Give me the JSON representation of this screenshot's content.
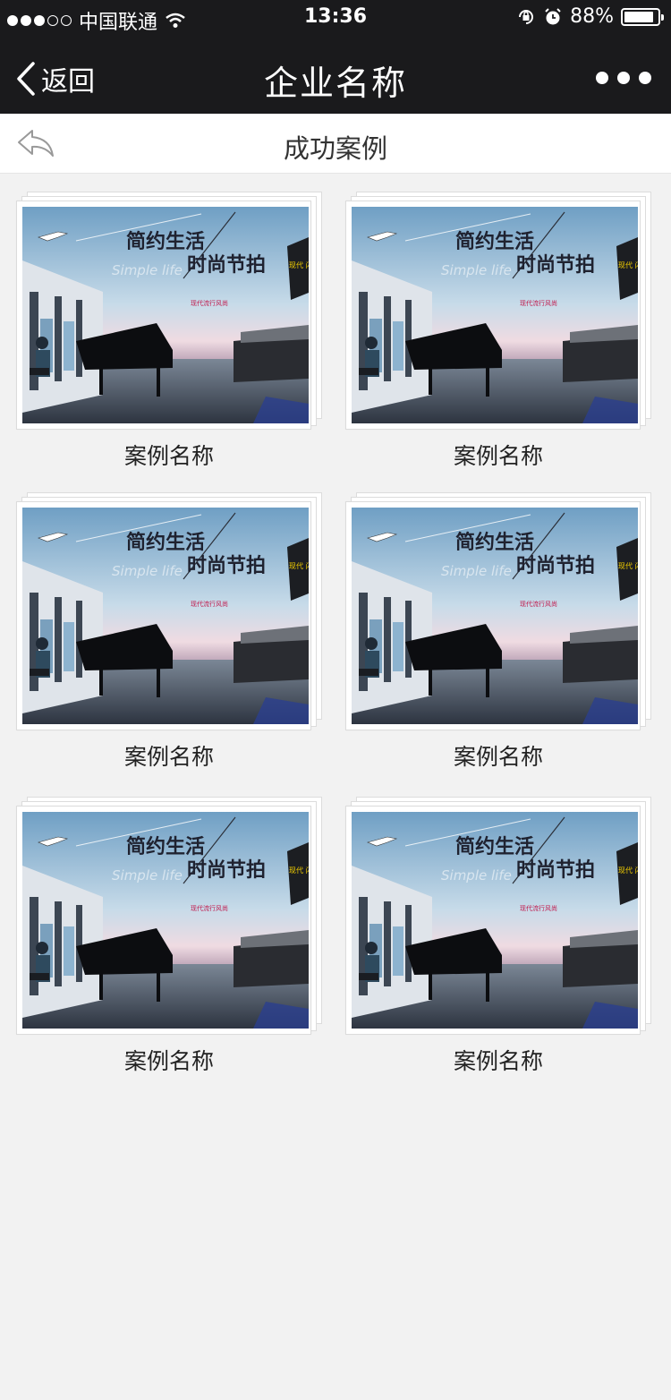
{
  "status_bar": {
    "carrier": "中国联通",
    "time": "13:36",
    "battery": "88%",
    "battery_level": 0.88
  },
  "nav": {
    "back_label": "返回",
    "title": "企业名称",
    "more_icon": "more-dots-icon"
  },
  "subheader": {
    "title": "成功案例",
    "back_icon": "reply-arrow-icon"
  },
  "poster": {
    "headline1": "简约生活",
    "headline2": "时尚节拍",
    "watermark": "Simple life",
    "tag": "现代流行风尚",
    "badge": "现代 闪亮"
  },
  "cases": [
    {
      "name": "案例名称"
    },
    {
      "name": "案例名称"
    },
    {
      "name": "案例名称"
    },
    {
      "name": "案例名称"
    },
    {
      "name": "案例名称"
    },
    {
      "name": "案例名称"
    }
  ]
}
